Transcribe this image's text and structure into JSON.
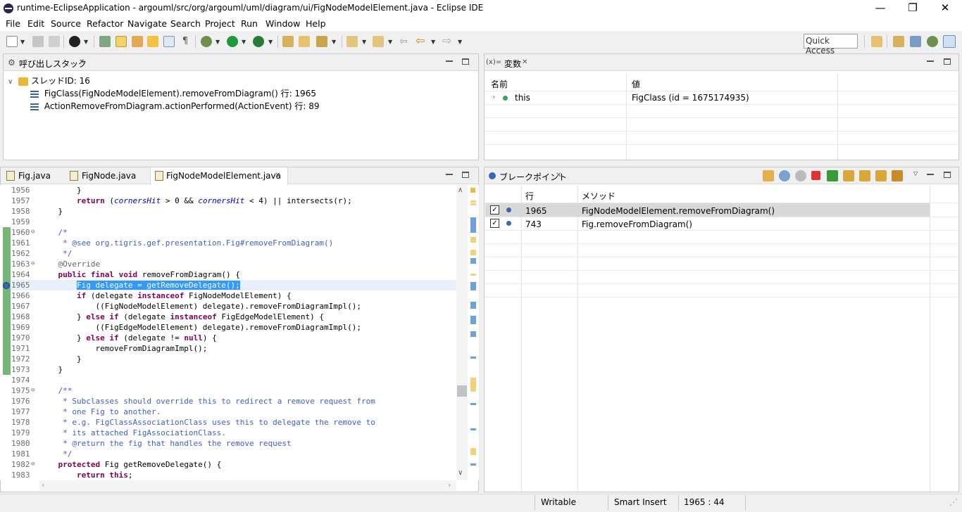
{
  "window": {
    "title": "runtime-EclipseApplication - argouml/src/org/argouml/uml/diagram/ui/FigNodeModelElement.java - Eclipse IDE",
    "minimize": "—",
    "restore": "❐",
    "close": "✕"
  },
  "menu": [
    "File",
    "Edit",
    "Source",
    "Refactor",
    "Navigate",
    "Search",
    "Project",
    "Run",
    "Window",
    "Help"
  ],
  "toolbar": {
    "quick_access_placeholder": "Quick Access",
    "icons": [
      "new-icon",
      "save-icon",
      "save-all-icon",
      "profile-icon",
      "open-type-icon",
      "highlight-icon",
      "open-resource-icon",
      "task-icon",
      "show-whitespace-icon",
      "debug-icon",
      "run-icon",
      "coverage-icon",
      "new-package-icon",
      "open-folder-icon",
      "search-tool-icon",
      "next-annotation-icon",
      "prev-annotation-icon",
      "last-edit-icon",
      "back-icon",
      "forward-icon"
    ]
  },
  "callstack": {
    "tab_label": "呼び出しスタック",
    "thread": "スレッドID: 16",
    "frames": [
      "FigClass(FigNodeModelElement).removeFromDiagram() 行: 1965",
      "ActionRemoveFromDiagram.actionPerformed(ActionEvent) 行: 89"
    ]
  },
  "variables": {
    "tab_prefix": "(x)=",
    "tab_label": "変数",
    "col_name": "名前",
    "col_value": "値",
    "rows": [
      {
        "name": "this",
        "value": "FigClass (id = 1675174935)"
      }
    ]
  },
  "editor": {
    "tabs": [
      {
        "label": "Fig.java",
        "active": false
      },
      {
        "label": "FigNode.java",
        "active": false
      },
      {
        "label": "FigNodeModelElement.java",
        "active": true
      }
    ],
    "lines": [
      {
        "n": "1956",
        "fold": "",
        "html": "        }"
      },
      {
        "n": "1957",
        "fold": "",
        "html": "        <span class=\"kw\">return</span> (<span class=\"fld\">cornersHit</span> &gt; 0 &amp;&amp; <span class=\"fld\">cornersHit</span> &lt; 4) || intersects(<span class=\"lv\">r</span>);"
      },
      {
        "n": "1958",
        "fold": "",
        "html": "    }"
      },
      {
        "n": "1959",
        "fold": "",
        "html": ""
      },
      {
        "n": "1960",
        "fold": "⊖",
        "html": "    <span class=\"jd\">/*</span>"
      },
      {
        "n": "1961",
        "fold": "",
        "html": "<span class=\"jd\">     * @see org.tigris.gef.presentation.Fig#removeFromDiagram()</span>"
      },
      {
        "n": "1962",
        "fold": "",
        "html": "<span class=\"jd\">     */</span>"
      },
      {
        "n": "1963",
        "fold": "⊖",
        "html": "    <span class=\"an\">@Override</span>"
      },
      {
        "n": "1964",
        "fold": "",
        "html": "    <span class=\"kw\">public</span> <span class=\"kw\">final</span> <span class=\"kw\">void</span> removeFromDiagram() {"
      },
      {
        "n": "1965",
        "fold": "",
        "html": "        <span class=\"sel\">Fig delegate = getRemoveDelegate();</span>",
        "selected": true
      },
      {
        "n": "1966",
        "fold": "",
        "html": "        <span class=\"kw\">if</span> (delegate <span class=\"kw\">instanceof</span> FigNodeModelElement) {"
      },
      {
        "n": "1967",
        "fold": "",
        "html": "            ((FigNodeModelElement) delegate).removeFromDiagramImpl();"
      },
      {
        "n": "1968",
        "fold": "",
        "html": "        } <span class=\"kw\">else</span> <span class=\"kw\">if</span> (delegate <span class=\"kw\">instanceof</span> FigEdgeModelElement) {"
      },
      {
        "n": "1969",
        "fold": "",
        "html": "            ((FigEdgeModelElement) delegate).removeFromDiagramImpl();"
      },
      {
        "n": "1970",
        "fold": "",
        "html": "        } <span class=\"kw\">else</span> <span class=\"kw\">if</span> (delegate != <span class=\"kw\">null</span>) {"
      },
      {
        "n": "1971",
        "fold": "",
        "html": "            removeFromDiagramImpl();"
      },
      {
        "n": "1972",
        "fold": "",
        "html": "        }"
      },
      {
        "n": "1973",
        "fold": "",
        "html": "    }"
      },
      {
        "n": "1974",
        "fold": "",
        "html": ""
      },
      {
        "n": "1975",
        "fold": "⊖",
        "html": "    <span class=\"jd\">/**</span>"
      },
      {
        "n": "1976",
        "fold": "",
        "html": "<span class=\"jd\">     * Subclasses should override this to redirect a remove request from</span>"
      },
      {
        "n": "1977",
        "fold": "",
        "html": "<span class=\"jd\">     * one Fig to another.</span>"
      },
      {
        "n": "1978",
        "fold": "",
        "html": "<span class=\"jd\">     * e.g. FigClassAssociationClass uses this to delegate the remove to</span>"
      },
      {
        "n": "1979",
        "fold": "",
        "html": "<span class=\"jd\">     * its attached FigAssociationClass.</span>"
      },
      {
        "n": "1980",
        "fold": "",
        "html": "<span class=\"jd\">     * @return the fig that handles the remove request</span>"
      },
      {
        "n": "1981",
        "fold": "",
        "html": "<span class=\"jd\">     */</span>"
      },
      {
        "n": "1982",
        "fold": "⊖",
        "html": "    <span class=\"kw\">protected</span> Fig getRemoveDelegate() {"
      },
      {
        "n": "1983",
        "fold": "",
        "html": "        <span class=\"kw\">return</span> <span class=\"kw\">this</span>;"
      }
    ]
  },
  "breakpoints": {
    "tab_label": "ブレークポイント",
    "col_line": "行",
    "col_method": "メソッド",
    "rows": [
      {
        "checked": true,
        "line": "1965",
        "method": "FigNodeModelElement.removeFromDiagram()",
        "selected": true
      },
      {
        "checked": true,
        "line": "743",
        "method": "Fig.removeFromDiagram()",
        "selected": false
      }
    ]
  },
  "status": {
    "writable": "Writable",
    "insert_mode": "Smart Insert",
    "position": "1965 : 44"
  }
}
